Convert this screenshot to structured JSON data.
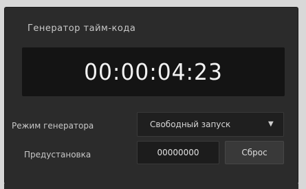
{
  "panel": {
    "title": "Генератор тайм-кода"
  },
  "timecode": {
    "value": "00:00:04:23"
  },
  "mode_row": {
    "label": "Режим генератора",
    "selected": "Свободный запуск",
    "arrow_icon": "chevron-down-icon"
  },
  "preset_row": {
    "label": "Предустановка",
    "value": "00000000",
    "apply_label": "Сброс"
  },
  "colors": {
    "panel_bg": "#2b2b2b",
    "display_bg": "#141414",
    "text_primary": "#f2f2f2",
    "text_secondary": "#c8c8c8"
  }
}
